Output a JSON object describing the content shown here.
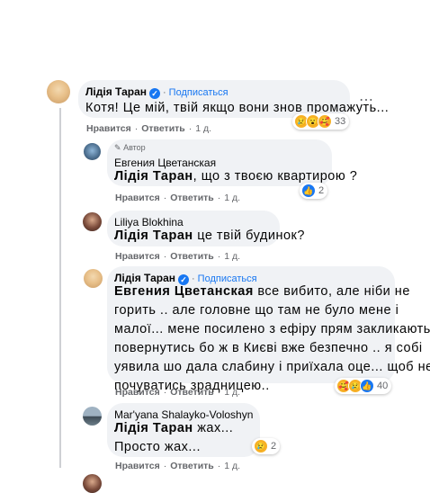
{
  "follow_label": "Подписаться",
  "author_badge_label": "Автор",
  "comments": [
    {
      "name": "Лідія Таран",
      "text": "Котя! Це мій, твій якщо вони знов промажуть...",
      "like": "Нравится",
      "reply": "Ответить",
      "time": "1 д.",
      "reactions_count": "33"
    },
    {
      "name": "Евгения Цветанская",
      "mention": "Лідія Таран",
      "text": ", що з твоєю квартирою ?",
      "like": "Нравится",
      "reply": "Ответить",
      "time": "1 д.",
      "reactions_count": "2"
    },
    {
      "name": "Liliya Blokhina",
      "mention": "Лідія Таран",
      "text": " це твій будинок?",
      "like": "Нравится",
      "reply": "Ответить",
      "time": "1 д."
    },
    {
      "name": "Лідія Таран",
      "mention": "Евгения Цветанская",
      "text_line1": " все вибито, але ніби не",
      "text_line2": "горить .. але головне що там не було мене і",
      "text_line3": "малої... мене посилено з ефіру прям закликають",
      "text_line4": "повернутись бо ж в Києві вже безпечно .. я собі",
      "text_line5": "уявила шо дала слабину і приїхала оце... щоб не",
      "text_line6": "почуватись зрадницею..",
      "like": "Нравится",
      "reply": "Ответить",
      "time": "1 д.",
      "reactions_count": "40"
    },
    {
      "name": "Mar'yana Shalayko-Voloshyn",
      "mention": "Лідія Таран",
      "text_line1": " жах...",
      "text_line2": "Просто жах...",
      "like": "Нравится",
      "reply": "Ответить",
      "time": "1 д.",
      "reactions_count": "2"
    }
  ],
  "colors": {
    "accent": "#1877f2",
    "bubble": "#f0f2f5",
    "meta": "#65676b"
  }
}
